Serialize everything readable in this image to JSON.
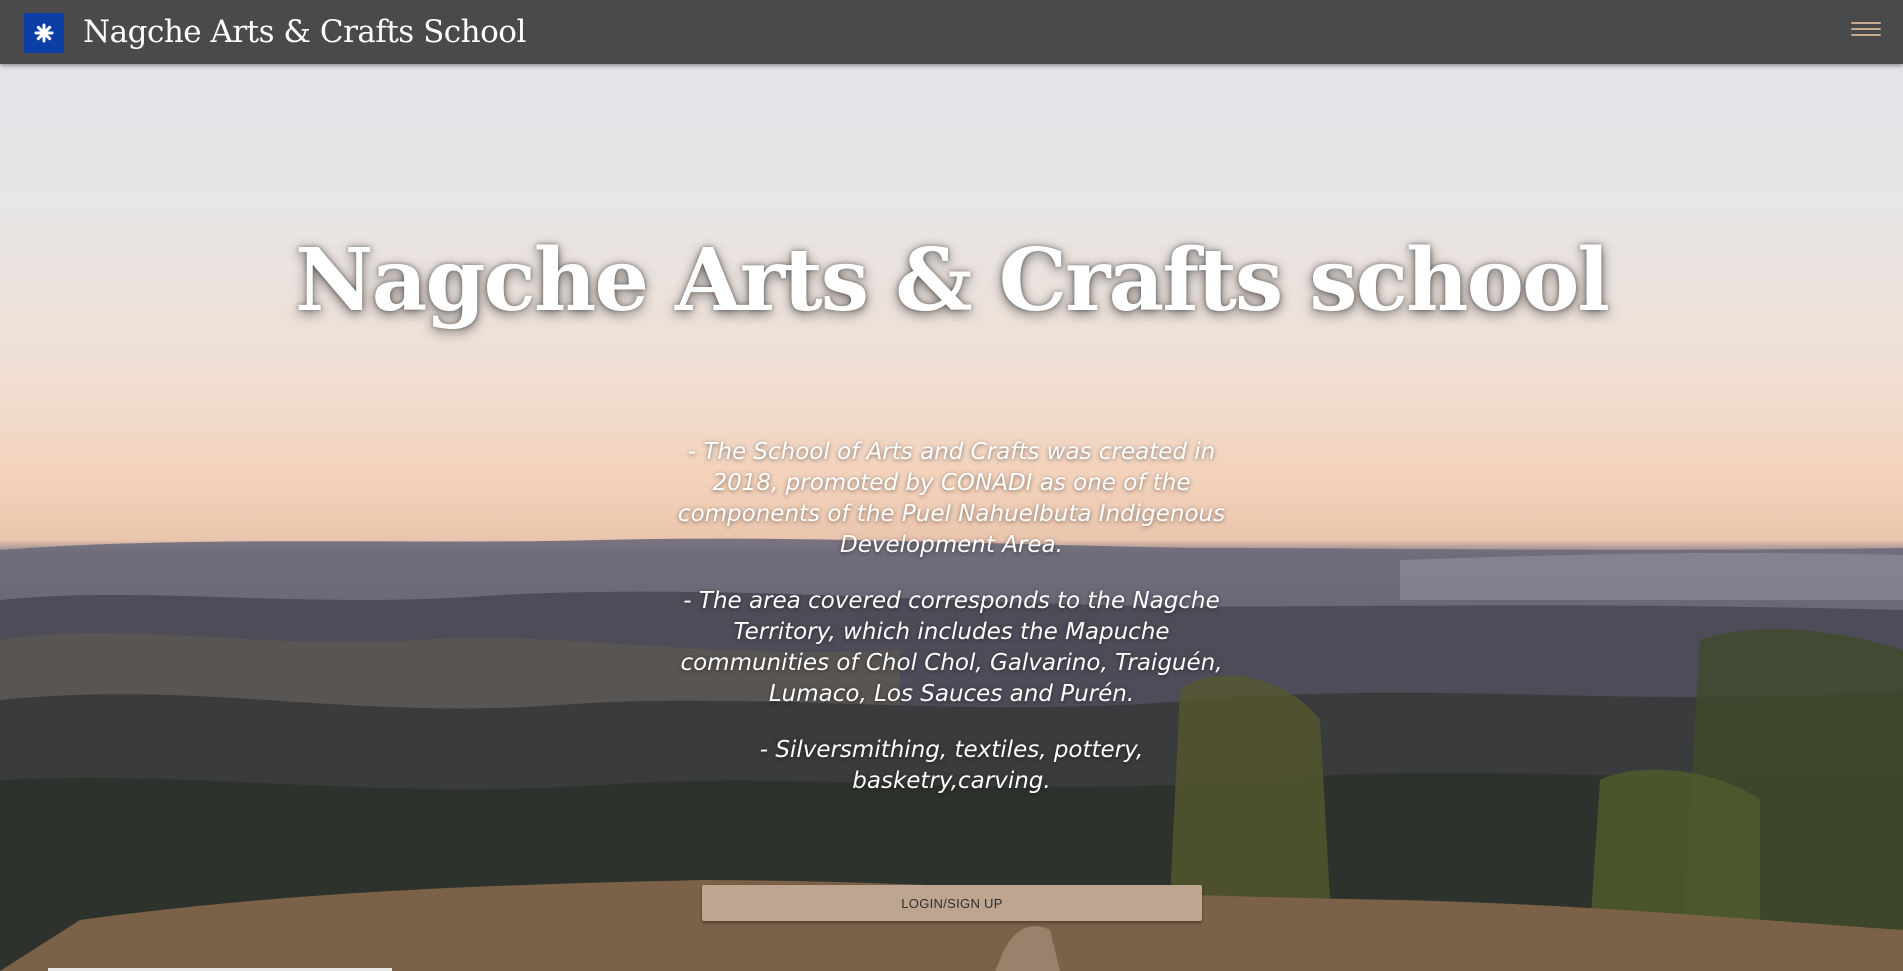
{
  "navbar": {
    "brand_title": "Nagche Arts & Crafts School",
    "logo_icon": "star-icon",
    "logo_color": "#0b3fa6",
    "menu_icon": "hamburger-menu-icon",
    "background_color": "#4a4a4a"
  },
  "hero": {
    "title": "Nagche Arts & Crafts school",
    "paragraphs": [
      "- The School of Arts and Crafts was created in 2018, promoted by CONADI as one of the components of the Puel Nahuelbuta Indigenous Development Area.",
      "- The area covered corresponds to the Nagche Territory, which includes the Mapuche communities of Chol Chol, Galvarino, Traiguén, Lumaco, Los Sauces and Purén.",
      "- Silversmithing, textiles, pottery, basketry,carving."
    ],
    "background_image": "landscape-hills-sunset"
  },
  "login_button": {
    "label": "LOGIN/SIGN UP",
    "color": "#bda58f"
  }
}
